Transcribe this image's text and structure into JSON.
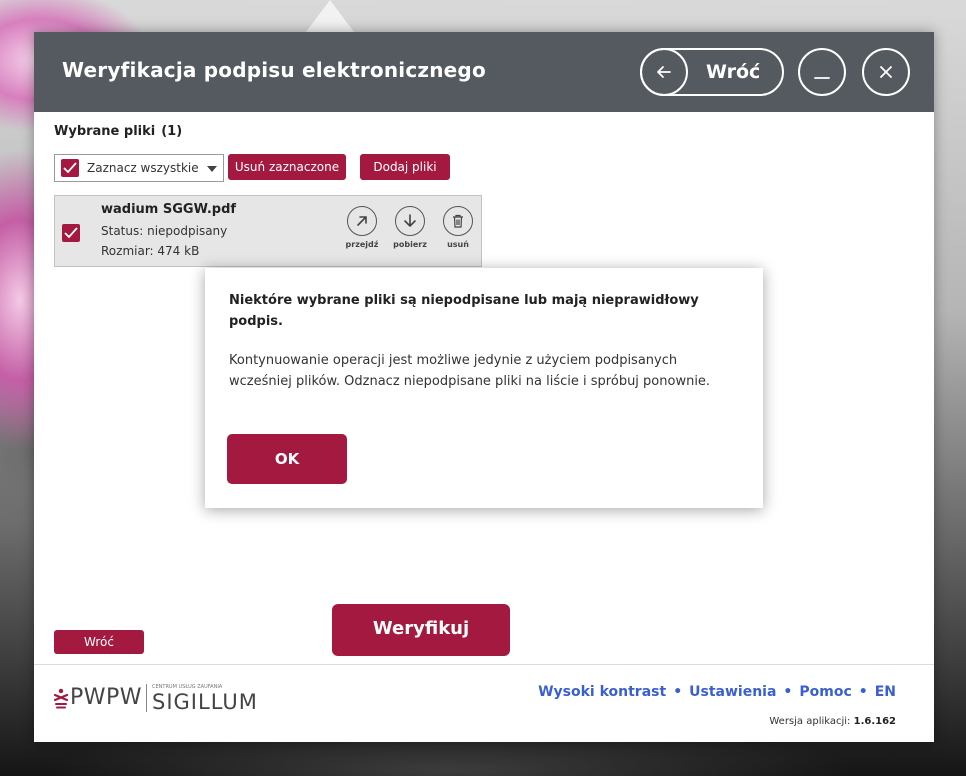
{
  "window": {
    "title": "Weryfikacja podpisu elektronicznego",
    "back_label": "Wróć",
    "back_icon": "arrow-left-icon",
    "minimize_icon": "minimize-icon",
    "close_icon": "close-icon"
  },
  "files": {
    "header": "Wybrane pliki",
    "count": "(1)",
    "select_all_label": "Zaznacz wszystkie",
    "remove_selected_label": "Usuń zaznaczone",
    "add_files_label": "Dodaj pliki",
    "items": [
      {
        "name": "wadium SGGW.pdf",
        "status": "Status: niepodpisany",
        "size": "Rozmiar: 474 kB",
        "checked": true,
        "actions": [
          {
            "label": "przejdź",
            "icon": "arrow-up-right-icon"
          },
          {
            "label": "pobierz",
            "icon": "arrow-down-icon"
          },
          {
            "label": "usuń",
            "icon": "trash-icon"
          }
        ]
      }
    ]
  },
  "bottom": {
    "back_label": "Wróć",
    "verify_label": "Weryfikuj"
  },
  "footer": {
    "logo_pwpw": "PWPW",
    "logo_cuz": "CENTRUM USŁUG ZAUFANIA",
    "logo_sigillum": "SIGILLUM",
    "links": [
      "Wysoki kontrast",
      "Ustawienia",
      "Pomoc",
      "EN"
    ],
    "version_label": "Wersja aplikacji:",
    "version_value": "1.6.162"
  },
  "modal": {
    "heading": "Niektóre wybrane pliki są niepodpisane lub mają nieprawidłowy podpis.",
    "body": "Kontynuowanie operacji jest możliwe jedynie z użyciem podpisanych wcześniej plików. Odznacz niepodpisane pliki na liście i spróbuj ponownie.",
    "ok_label": "OK"
  },
  "colors": {
    "accent": "#a3193f",
    "titlebar": "#545a60",
    "link": "#3a5fd0"
  }
}
